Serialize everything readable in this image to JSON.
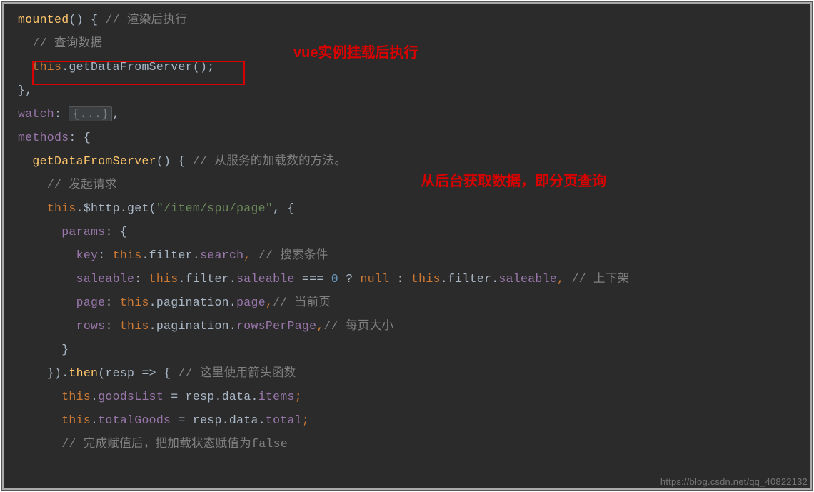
{
  "annotations": {
    "box_highlight_line": "this.getDataFromServer();",
    "anno1": "vue实例挂载后执行",
    "anno2": "从后台获取数据，即分页查询"
  },
  "code": {
    "l1": {
      "func": "mounted",
      "paren": "()",
      "brace": " { ",
      "comment": "// 渲染后执行"
    },
    "l2": {
      "comment": "// 查询数据"
    },
    "l3": {
      "this": "this",
      "dot": ".",
      "call": "getDataFromServer",
      "paren": "();"
    },
    "l4": {
      "brace": "},"
    },
    "l5": {
      "prop": "watch",
      "colon": ": ",
      "fold": "{...}",
      "comma": ","
    },
    "l6": {
      "prop": "methods",
      "colon": ": {"
    },
    "l7": {
      "func": "getDataFromServer",
      "paren": "()",
      "brace": " { ",
      "comment": "// 从服务的加载数的方法。"
    },
    "l8": {
      "comment": "// 发起请求"
    },
    "l9": {
      "this": "this",
      "d1": ".",
      "http": "$http",
      "d2": ".",
      "get": "get",
      "p1": "(",
      "str": "\"/item/spu/page\"",
      "p2": ", {"
    },
    "l10": {
      "prop": "params",
      "rest": ": {"
    },
    "l11": {
      "prop": "key",
      "c": ": ",
      "this": "this",
      "d1": ".",
      "f": "filter",
      "d2": ".",
      "s": "search",
      "comma": ", ",
      "comment": "// 搜索条件"
    },
    "l12": {
      "prop": "saleable",
      "c": ": ",
      "this1": "this",
      "d1": ".",
      "f1": "filter",
      "d2": ".",
      "s1": "saleable",
      "eq": " === ",
      "num": "0",
      "q": " ? ",
      "null": "null",
      "colon2": " : ",
      "this2": "this",
      "d3": ".",
      "f2": "filter",
      "d4": ".",
      "s2": "saleable",
      "comma": ", ",
      "comment": "// 上下架"
    },
    "l13": {
      "prop": "page",
      "c": ": ",
      "this": "this",
      "d1": ".",
      "pg": "pagination",
      "d2": ".",
      "p": "page",
      "comma": ",",
      "comment": "// 当前页"
    },
    "l14": {
      "prop": "rows",
      "c": ": ",
      "this": "this",
      "d1": ".",
      "pg": "pagination",
      "d2": ".",
      "r": "rowsPerPage",
      "comma": ",",
      "comment": "// 每页大小"
    },
    "l15": {
      "brace": "}"
    },
    "l16": {
      "p1": "}).",
      "then": "then",
      "p2": "(",
      "resp": "resp",
      "arrow": " => ",
      "brace": "{ ",
      "comment": "// 这里使用箭头函数"
    },
    "l17": {
      "this": "this",
      "d1": ".",
      "gl": "goodsList",
      "eq": " = ",
      "resp": "resp",
      "d2": ".",
      "data": "data",
      "d3": ".",
      "items": "items",
      "semi": ";"
    },
    "l18": {
      "this": "this",
      "d1": ".",
      "tg": "totalGoods",
      "eq": " = ",
      "resp": "resp",
      "d2": ".",
      "data": "data",
      "d3": ".",
      "total": "total",
      "semi": ";"
    },
    "l19": {
      "comment": "// 完成赋值后，把加载状态赋值为false"
    }
  },
  "watermark": "https://blog.csdn.net/qq_40822132"
}
